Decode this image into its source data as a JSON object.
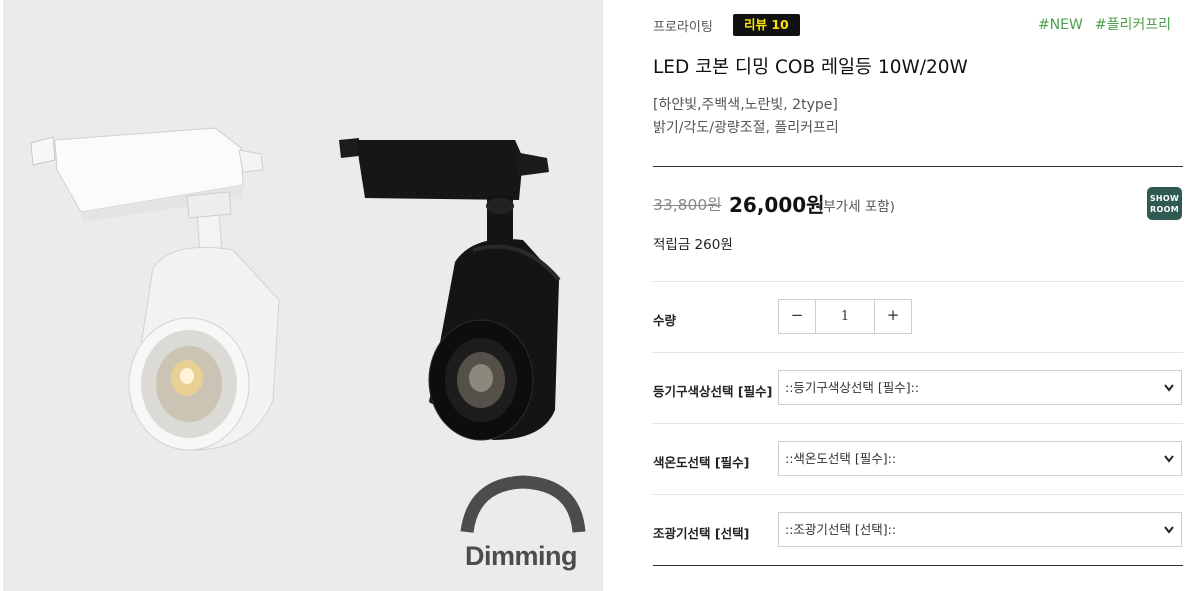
{
  "image": {
    "dimming_label": "Dimming"
  },
  "product": {
    "brand": "프로라이팅",
    "review_badge": "리뷰 10",
    "hashtags": [
      "#NEW",
      "#플리커프리"
    ],
    "title": "LED 코본 디밍 COB 레일등 10W/20W",
    "subtitle_1": "[하얀빛,주백색,노란빛, 2type]",
    "subtitle_2": "밝기/각도/광량조절, 플리커프리",
    "price_original": "33,800원",
    "price_sale": "26,000원",
    "vat_note": "(부가세 포함)",
    "showroom_label_1": "SHOW",
    "showroom_label_2": "ROOM",
    "points": "적립금 260원"
  },
  "options": {
    "quantity": {
      "label": "수량",
      "minus": "−",
      "value": "1",
      "plus": "+"
    },
    "body_color": {
      "label": "등기구색상선택 [필수]",
      "selected": "::등기구색상선택 [필수]::"
    },
    "color_temp": {
      "label": "색온도선택 [필수]",
      "selected": "::색온도선택 [필수]::"
    },
    "dimmer": {
      "label": "조광기선택 [선택]",
      "selected": "::조광기선택 [선택]::"
    }
  },
  "colors": {
    "accent_green": "#4aa14a",
    "badge_bg": "#111111",
    "badge_text": "#f8e400",
    "showroom_bg": "#2f5a52"
  }
}
